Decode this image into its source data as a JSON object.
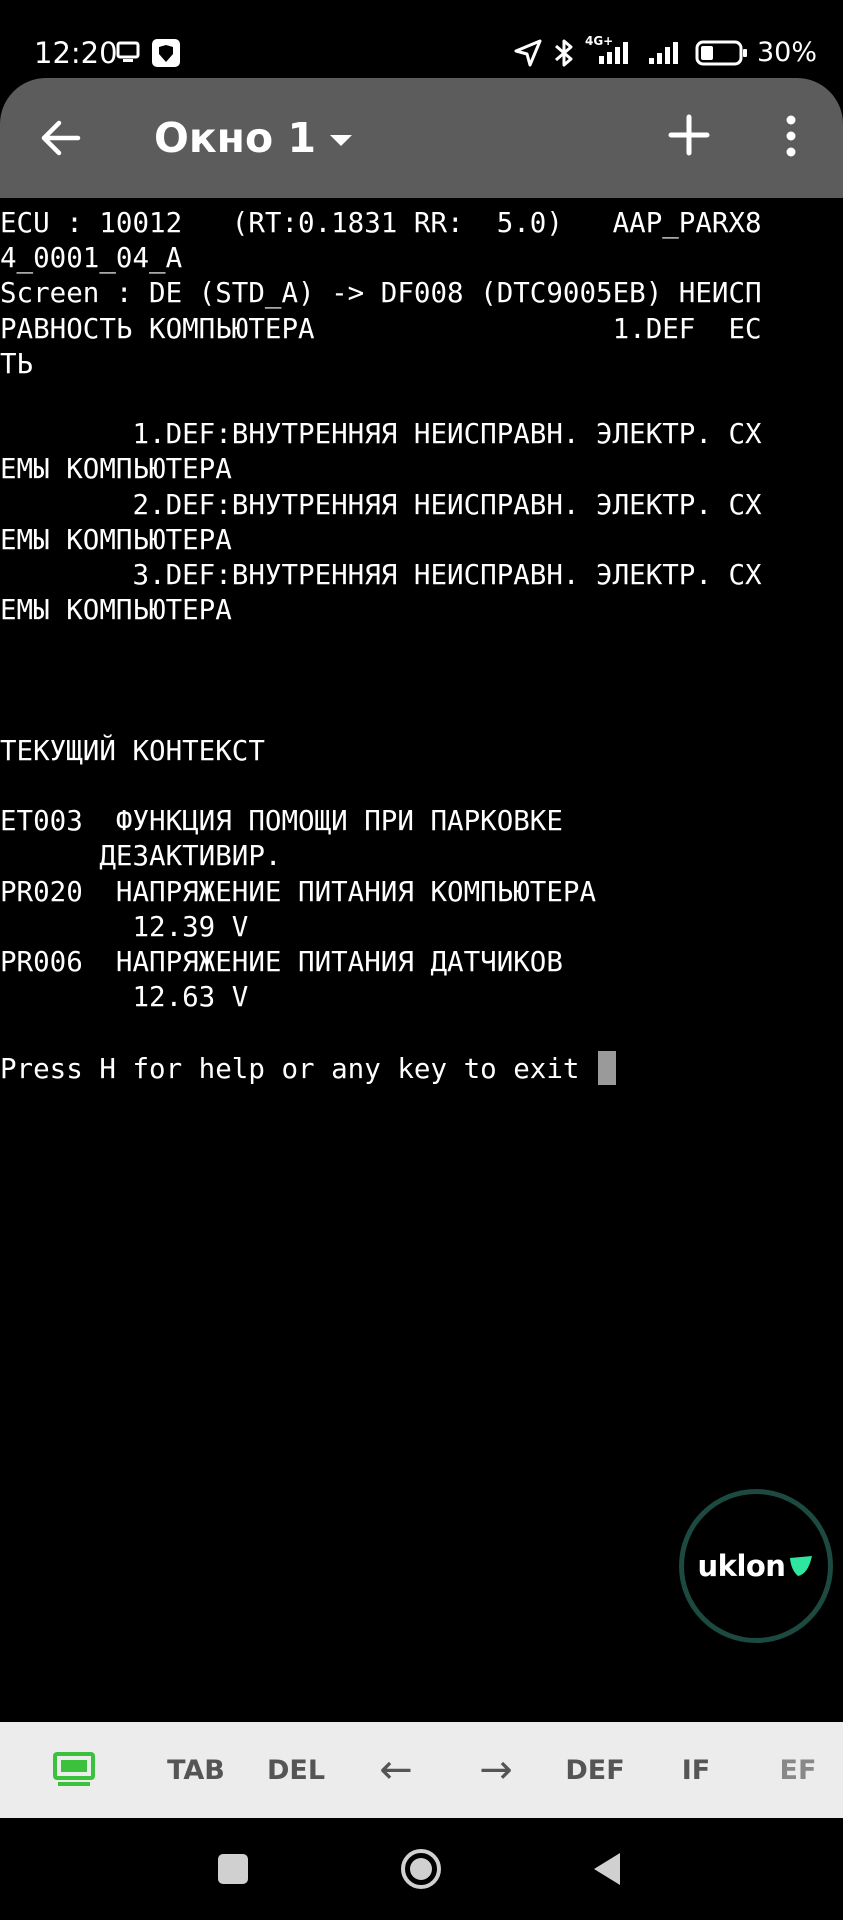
{
  "status_bar": {
    "time": "12:20",
    "battery": "30%",
    "network": "4G+"
  },
  "app_bar": {
    "title": "Окно 1"
  },
  "terminal": {
    "lines": [
      "ECU : 10012   (RT:0.1831 RR:  5.0)   AAP_PARX8",
      "4_0001_04_A",
      "Screen : DE (STD_A) -> DF008 (DTC9005EB) НЕИСП",
      "РАВНОСТЬ КОМПЬЮТЕРА                  1.DEF  ЕС",
      "ТЬ",
      "",
      "        1.DEF:ВНУТРЕННЯЯ НЕИСПРАВН. ЭЛЕКТР. СХ",
      "ЕМЫ КОМПЬЮТЕРА",
      "        2.DEF:ВНУТРЕННЯЯ НЕИСПРАВН. ЭЛЕКТР. СХ",
      "ЕМЫ КОМПЬЮТЕРА",
      "        3.DEF:ВНУТРЕННЯЯ НЕИСПРАВН. ЭЛЕКТР. СХ",
      "ЕМЫ КОМПЬЮТЕРА",
      "",
      "",
      "",
      "ТЕКУЩИЙ КОНТЕКСТ",
      "",
      "ET003  ФУНКЦИЯ ПОМОЩИ ПРИ ПАРКОВКЕ",
      "      ДЕЗАКТИВИР.",
      "PR020  НАПРЯЖЕНИЕ ПИТАНИЯ КОМПЬЮТЕРА",
      "        12.39 V",
      "PR006  НАПРЯЖЕНИЕ ПИТАНИЯ ДАТЧИКОВ",
      "        12.63 V",
      "",
      "Press H for help or any key to exit "
    ]
  },
  "floating": {
    "label": "uklon",
    "accent": "#2ee6a0"
  },
  "keybar": {
    "keys": [
      "TAB",
      "DEL",
      "←",
      "→",
      "DEF",
      "IF",
      "EF"
    ]
  },
  "colors": {
    "app_bar": "#5c5c5c",
    "keyboard_icon": "#3cc13c"
  }
}
